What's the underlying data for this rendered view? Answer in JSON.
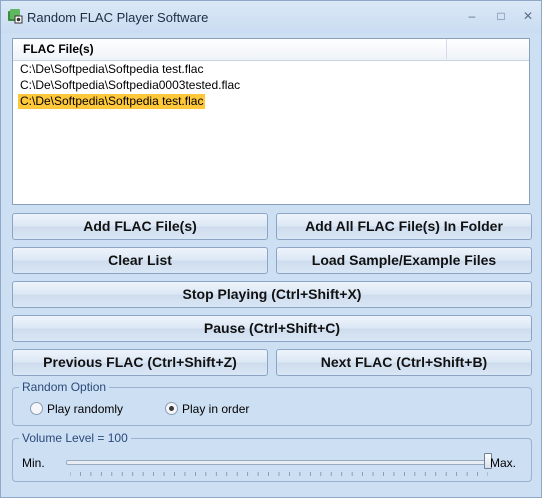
{
  "window": {
    "title": "Random FLAC Player Software",
    "minimize": "–",
    "maximize": "□",
    "close": "✕"
  },
  "file_list": {
    "column_header": "FLAC File(s)",
    "items": [
      "C:\\De\\Softpedia\\Softpedia test.flac",
      "C:\\De\\Softpedia\\Softpedia0003tested.flac",
      "C:\\De\\Softpedia\\Softpedia test.flac"
    ],
    "selected_index": 2
  },
  "buttons": {
    "add_files": "Add FLAC File(s)",
    "add_folder": "Add All FLAC File(s) In Folder",
    "clear_list": "Clear List",
    "load_samples": "Load Sample/Example Files",
    "stop": "Stop Playing (Ctrl+Shift+X)",
    "pause": "Pause (Ctrl+Shift+C)",
    "previous": "Previous FLAC (Ctrl+Shift+Z)",
    "next": "Next FLAC (Ctrl+Shift+B)"
  },
  "random_option": {
    "title": "Random Option",
    "play_randomly": "Play randomly",
    "play_in_order": "Play in order",
    "selected": "play_in_order"
  },
  "volume": {
    "title": "Volume Level = 100",
    "min_label": "Min.",
    "max_label": "Max.",
    "level": 100
  },
  "colors": {
    "selection": "#ffc83a",
    "window_bg": "#cddff3",
    "group_title": "#2a4a7a"
  }
}
